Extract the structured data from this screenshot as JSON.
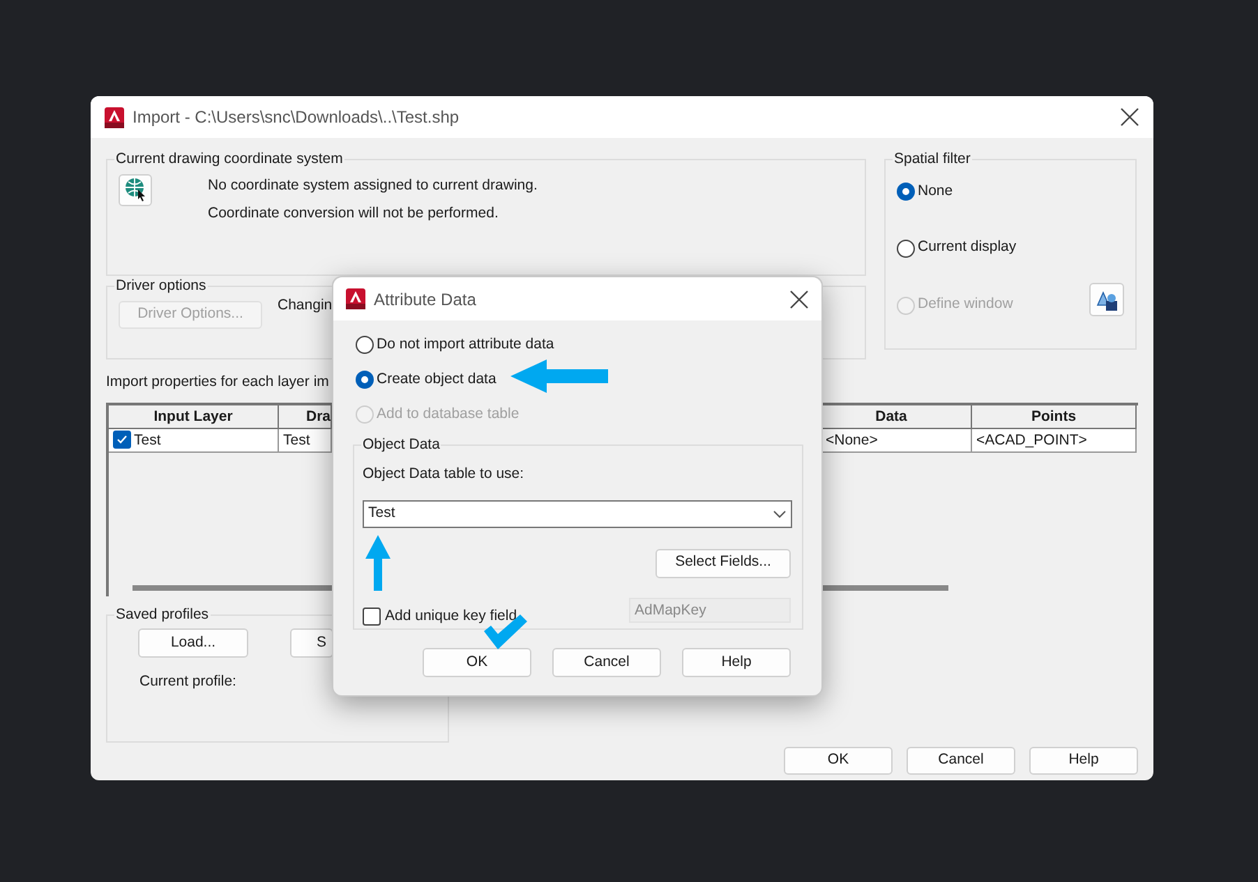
{
  "window": {
    "title": "Import - C:\\Users\\snc\\Downloads\\..\\Test.shp"
  },
  "coordinate_system": {
    "label": "Current drawing coordinate system",
    "messages": [
      "No coordinate system assigned to current drawing.",
      "Coordinate conversion will not be performed."
    ]
  },
  "spatial_filter": {
    "label": "Spatial filter",
    "options": [
      {
        "label": "None",
        "selected": true,
        "disabled": false
      },
      {
        "label": "Current display",
        "selected": false,
        "disabled": false
      },
      {
        "label": "Define window",
        "selected": false,
        "disabled": true
      }
    ]
  },
  "driver_options": {
    "label": "Driver options",
    "button": {
      "label": "Driver Options...",
      "disabled": true
    },
    "note": "Changin"
  },
  "layers": {
    "label": "Import properties for each layer im",
    "columns": [
      "Input Layer",
      "Dra",
      "Data",
      "Points"
    ],
    "rows": [
      {
        "checked": true,
        "cells": [
          "Test",
          "Test",
          "<None>",
          "<ACAD_POINT>"
        ]
      }
    ]
  },
  "saved_profiles": {
    "label": "Saved profiles",
    "buttons": [
      "Load...",
      "S"
    ],
    "current_profile_label": "Current profile:"
  },
  "buttons": [
    "OK",
    "Cancel",
    "Help"
  ],
  "attribute_dialog": {
    "title": "Attribute Data",
    "options": [
      {
        "label": "Do not import attribute data",
        "selected": false,
        "disabled": false
      },
      {
        "label": "Create object data",
        "selected": true,
        "disabled": false
      },
      {
        "label": "Add to database table",
        "selected": false,
        "disabled": true
      }
    ],
    "object_data": {
      "label": "Object Data",
      "table_label": "Object Data table to use:",
      "table_value": "Test",
      "select_fields": "Select Fields...",
      "unique_key": {
        "label": "Add unique key field",
        "checked": false
      },
      "key_name": "AdMapKey"
    },
    "buttons": [
      "OK",
      "Cancel",
      "Help"
    ]
  }
}
